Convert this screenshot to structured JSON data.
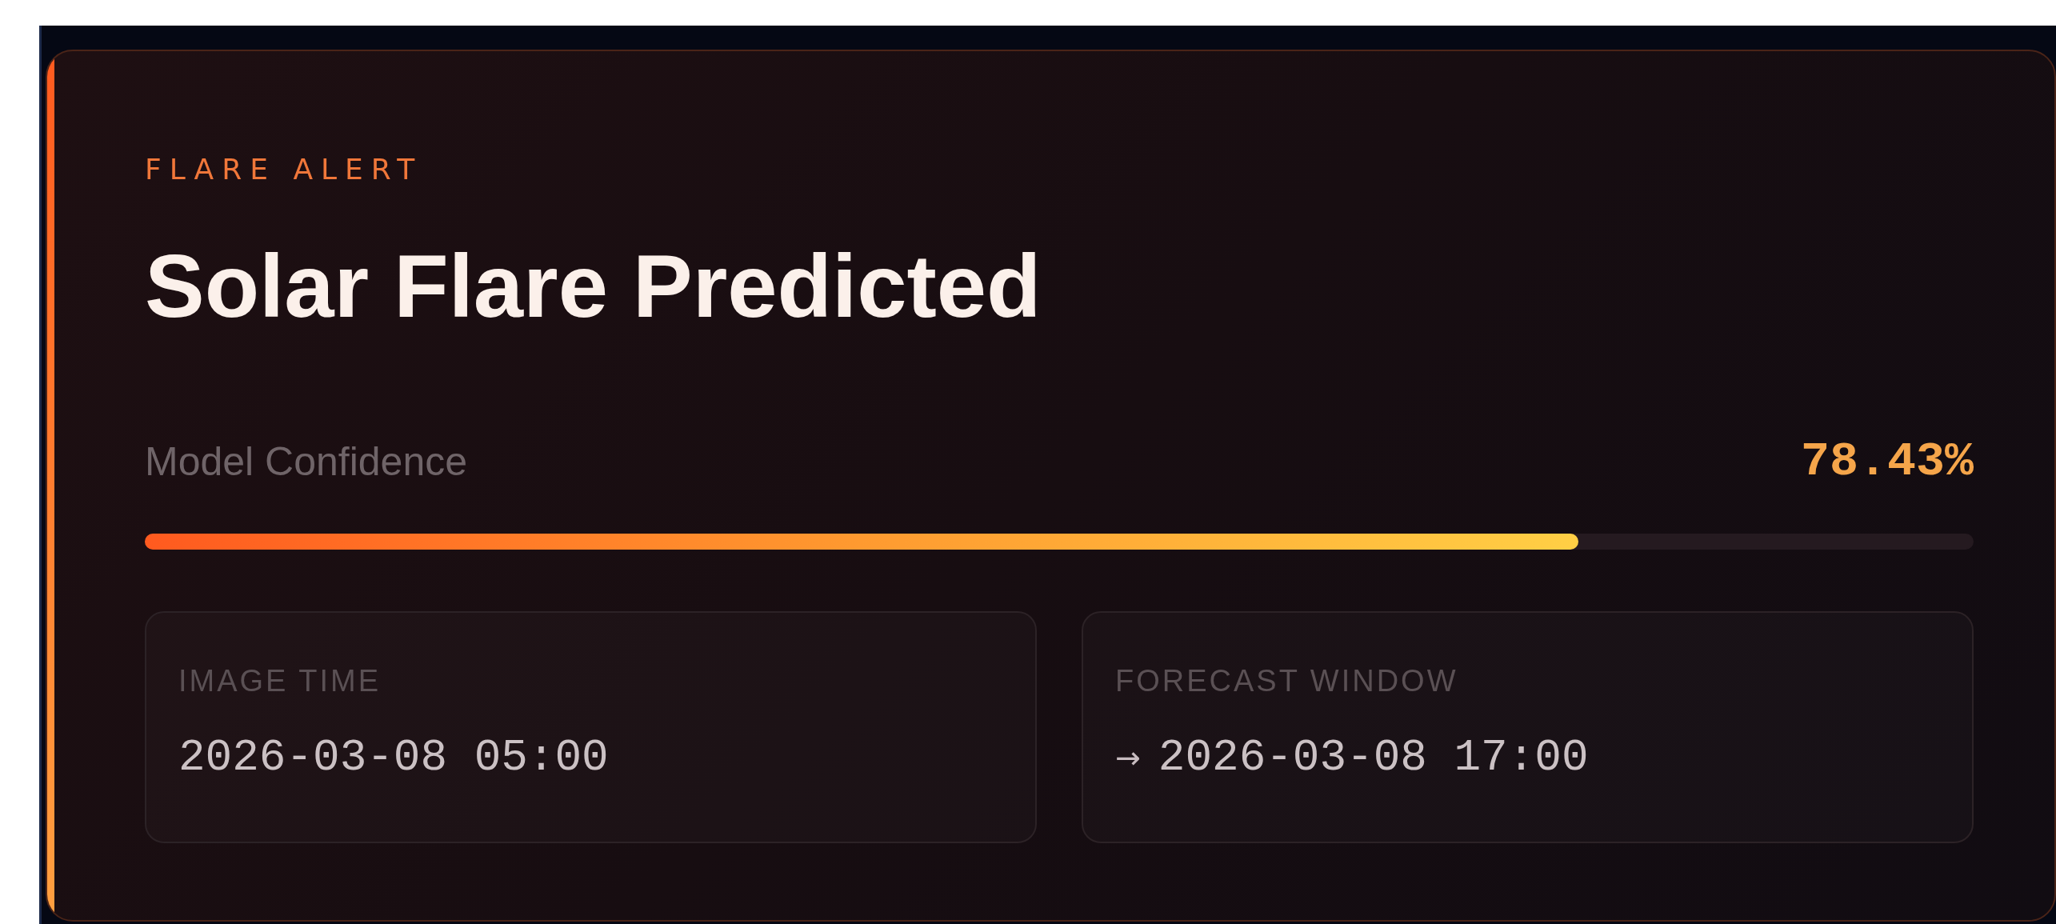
{
  "card": {
    "eyebrow": "FLARE ALERT",
    "title": "Solar Flare Predicted"
  },
  "confidence": {
    "label": "Model Confidence",
    "reading": "78.43%",
    "level": 0.784
  },
  "details": [
    {
      "label": "IMAGE TIME",
      "value": "2026-03-08 05:00"
    },
    {
      "label": "FORECAST WINDOW",
      "arrow": "→",
      "value": "2026-03-08 17:00"
    }
  ]
}
